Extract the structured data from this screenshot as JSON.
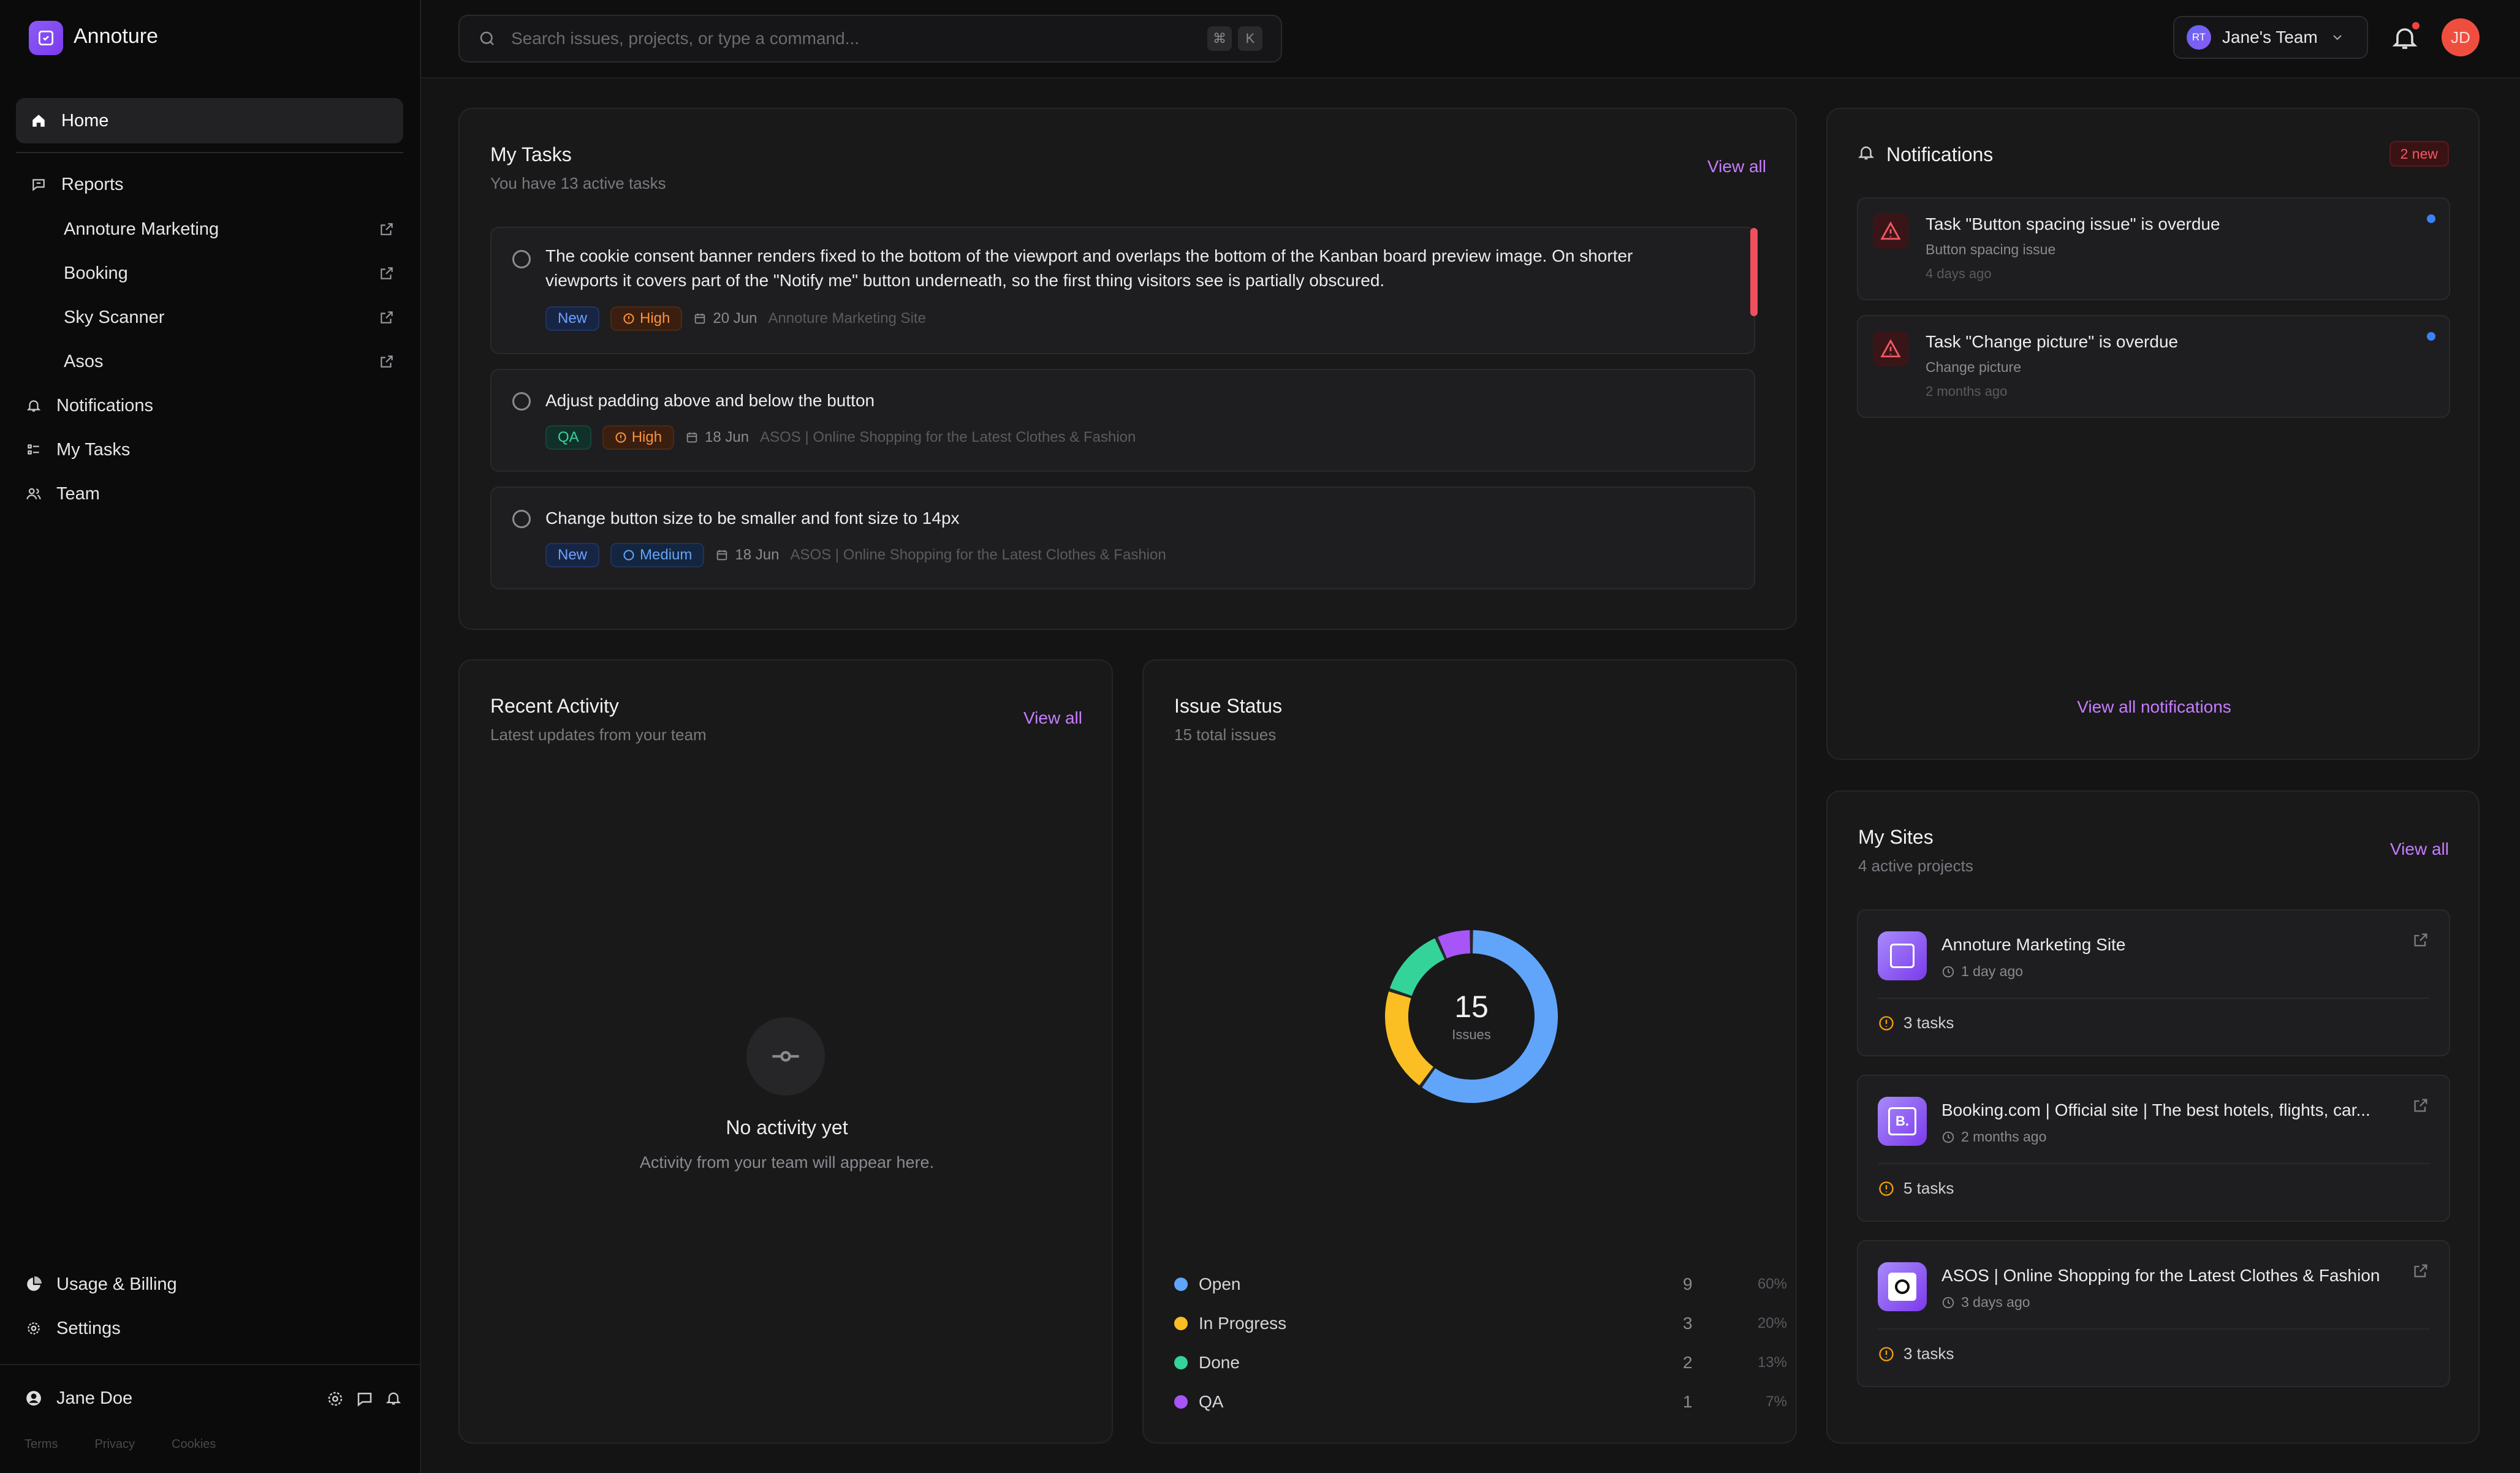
{
  "app": {
    "name": "Annoture"
  },
  "sidebar": {
    "home": "Home",
    "reports": "Reports",
    "report_items": [
      "Annoture Marketing",
      "Booking",
      "Sky Scanner",
      "Asos"
    ],
    "notifications": "Notifications",
    "my_tasks": "My Tasks",
    "team": "Team",
    "usage_billing": "Usage & Billing",
    "settings": "Settings",
    "user_name": "Jane Doe",
    "footer_links": [
      "Terms",
      "Privacy",
      "Cookies"
    ]
  },
  "topbar": {
    "search_placeholder": "Search issues, projects, or type a command...",
    "kbd": [
      "⌘",
      "K"
    ],
    "team_initials": "RT",
    "team_name": "Jane's Team",
    "user_initials": "JD"
  },
  "tasks": {
    "title": "My Tasks",
    "subtitle": "You have 13 active tasks",
    "view_all": "View all",
    "items": [
      {
        "text": "The cookie consent banner renders fixed to the bottom of the viewport and overlaps the bottom of the Kanban board preview image. On shorter viewports it covers part of the \"Notify me\" button underneath, so the first thing visitors see is partially obscured.",
        "status": "New",
        "priority": "High",
        "date": "20 Jun",
        "site": "Annoture Marketing Site"
      },
      {
        "text": "Adjust padding above and below the button",
        "status": "QA",
        "priority": "High",
        "date": "18 Jun",
        "site": "ASOS | Online Shopping for the Latest Clothes & Fashion"
      },
      {
        "text": "Change button size to be smaller and font size to 14px",
        "status": "New",
        "priority": "Medium",
        "date": "18 Jun",
        "site": "ASOS | Online Shopping for the Latest Clothes & Fashion"
      }
    ]
  },
  "notifications": {
    "title": "Notifications",
    "badge": "2 new",
    "view_all": "View all notifications",
    "items": [
      {
        "title": "Task \"Button spacing issue\" is overdue",
        "subtitle": "Button spacing issue",
        "time": "4 days ago"
      },
      {
        "title": "Task \"Change picture\" is overdue",
        "subtitle": "Change picture",
        "time": "2 months ago"
      }
    ]
  },
  "activity": {
    "title": "Recent Activity",
    "subtitle": "Latest updates from your team",
    "view_all": "View all",
    "empty_title": "No activity yet",
    "empty_sub": "Activity from your team will appear here."
  },
  "issue_status": {
    "title": "Issue Status",
    "subtitle": "15 total issues",
    "center_value": "15",
    "center_label": "Issues",
    "rows": [
      {
        "label": "Open",
        "count": "9",
        "pct": "60%",
        "color": "#60a5fa"
      },
      {
        "label": "In Progress",
        "count": "3",
        "pct": "20%",
        "color": "#fbbf24"
      },
      {
        "label": "Done",
        "count": "2",
        "pct": "13%",
        "color": "#34d399"
      },
      {
        "label": "QA",
        "count": "1",
        "pct": "7%",
        "color": "#a855f7"
      }
    ]
  },
  "sites": {
    "title": "My Sites",
    "subtitle": "4 active projects",
    "view_all": "View all",
    "items": [
      {
        "name": "Annoture Marketing Site",
        "time": "1 day ago",
        "tasks": "3 tasks"
      },
      {
        "name": "Booking.com | Official site | The best hotels, flights, car...",
        "time": "2 months ago",
        "tasks": "5 tasks"
      },
      {
        "name": "ASOS | Online Shopping for the Latest Clothes & Fashion",
        "time": "3 days ago",
        "tasks": "3 tasks"
      }
    ]
  },
  "colors": {
    "accent": "#c77dff",
    "brand": "#8b5cf6",
    "danger": "#f0505e"
  }
}
